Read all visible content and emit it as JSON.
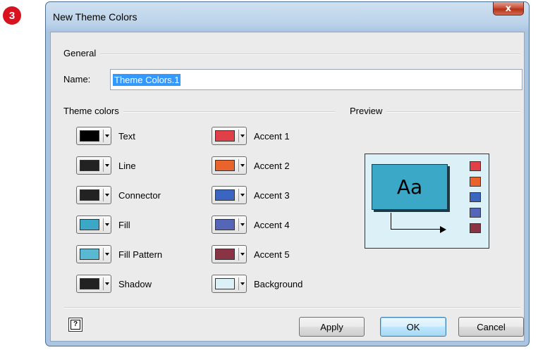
{
  "step_badge": "3",
  "window": {
    "title": "New Theme Colors",
    "close_label": "x"
  },
  "general": {
    "group_label": "General",
    "name_label": "Name:",
    "name_value": "Theme Colors.1"
  },
  "theme_colors": {
    "group_label": "Theme colors",
    "left_column": [
      {
        "label": "Text",
        "color": "#000000"
      },
      {
        "label": "Line",
        "color": "#222222"
      },
      {
        "label": "Connector",
        "color": "#222222"
      },
      {
        "label": "Fill",
        "color": "#3aa8c6"
      },
      {
        "label": "Fill Pattern",
        "color": "#5ab9d2"
      },
      {
        "label": "Shadow",
        "color": "#222222"
      }
    ],
    "right_column": [
      {
        "label": "Accent 1",
        "color": "#e04048"
      },
      {
        "label": "Accent 2",
        "color": "#e8642c"
      },
      {
        "label": "Accent 3",
        "color": "#3a66c2"
      },
      {
        "label": "Accent 4",
        "color": "#5565b8"
      },
      {
        "label": "Accent 5",
        "color": "#8a3345"
      },
      {
        "label": "Background",
        "color": "#dbf1f7"
      }
    ]
  },
  "preview": {
    "group_label": "Preview",
    "sample_text": "Aa",
    "accent_swatches": [
      "#e04048",
      "#e8642c",
      "#3a66c2",
      "#5565b8",
      "#8a3345"
    ]
  },
  "footer": {
    "help_icon": "help-icon",
    "apply_label": "Apply",
    "ok_label": "OK",
    "cancel_label": "Cancel"
  }
}
